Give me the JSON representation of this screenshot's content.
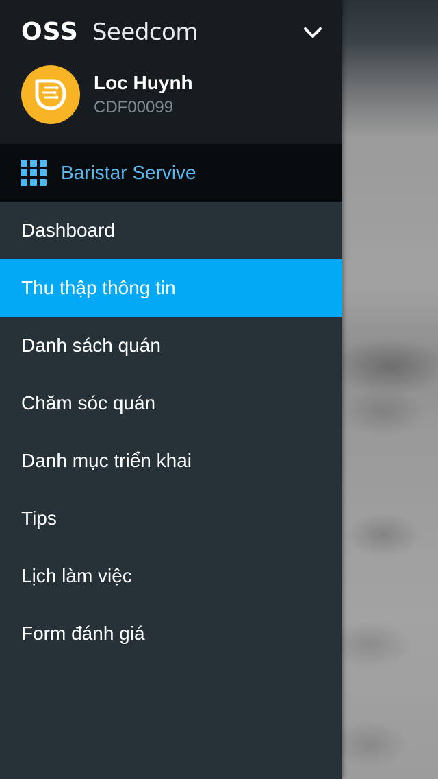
{
  "header": {
    "brand_primary": "OSS",
    "brand_secondary": "Seedcom",
    "chevron_icon": "chevron-down-icon"
  },
  "user": {
    "name": "Loc Huynh",
    "id": "CDF00099",
    "avatar_icon": "leaf-logo-icon",
    "avatar_color": "#F9B425"
  },
  "app_switcher": {
    "icon": "apps-grid-icon",
    "label": "Baristar Servive",
    "color": "#57B9F0"
  },
  "menu": {
    "active_index": 1,
    "active_color": "#03A9F4",
    "items": [
      {
        "label": "Dashboard"
      },
      {
        "label": "Thu thập thông tin"
      },
      {
        "label": "Danh sách quán"
      },
      {
        "label": "Chăm sóc quán"
      },
      {
        "label": "Danh mục triển khai"
      },
      {
        "label": "Tips"
      },
      {
        "label": "Lịch làm việc"
      },
      {
        "label": "Form đánh giá"
      }
    ]
  },
  "colors": {
    "drawer_bg": "#263238",
    "header_bg": "#171C20",
    "switcher_bg": "#080B0D"
  }
}
